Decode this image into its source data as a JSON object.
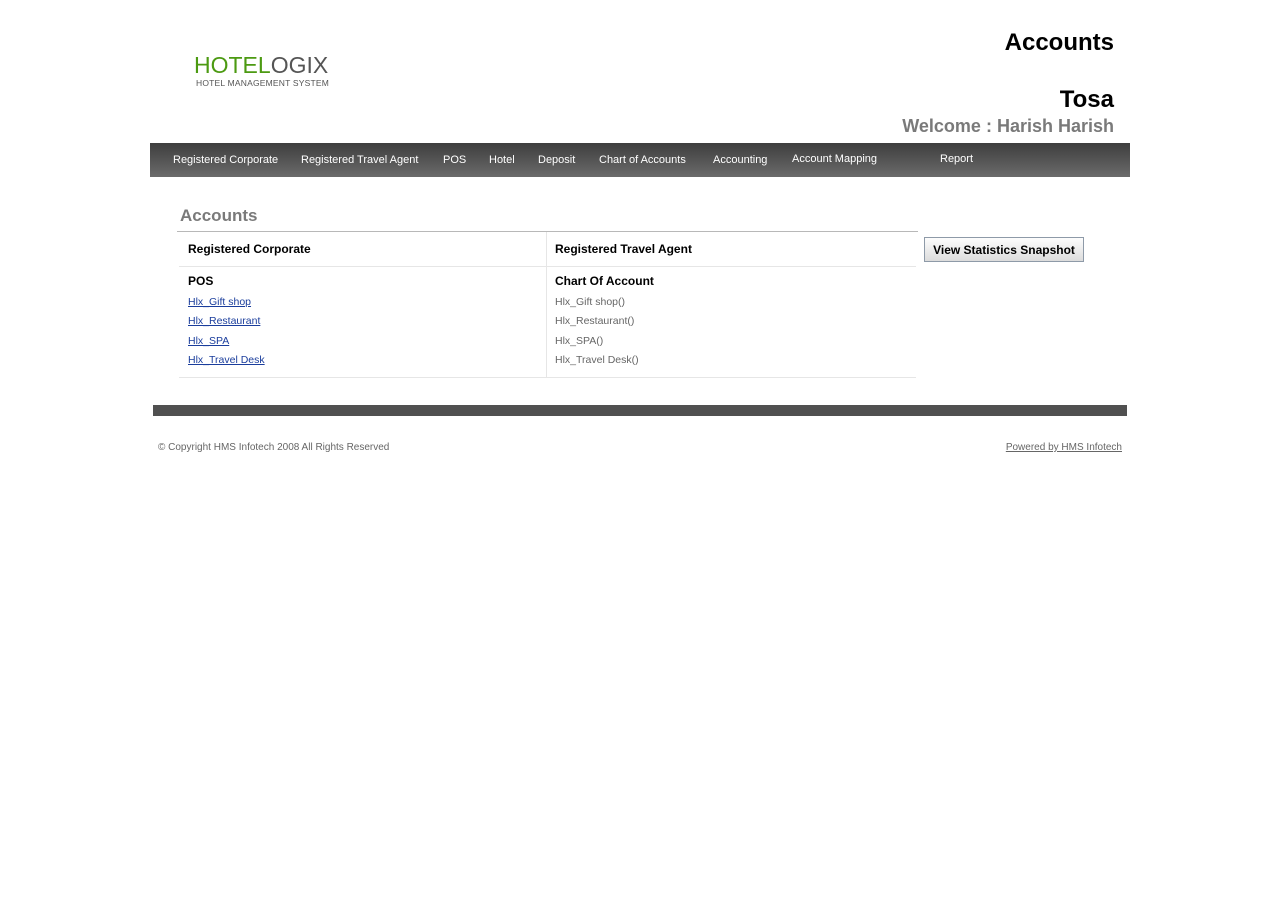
{
  "header": {
    "logo_part1": "HOTEL",
    "logo_part2": "OGIX",
    "logo_subtitle": "HOTEL MANAGEMENT SYSTEM",
    "page_heading": "Accounts",
    "hotel_name": "Tosa",
    "welcome": "Welcome : Harish Harish"
  },
  "nav": {
    "items": [
      {
        "label": "Registered Corporate"
      },
      {
        "label": "Registered Travel Agent"
      },
      {
        "label": "POS"
      },
      {
        "label": "Hotel"
      },
      {
        "label": "Deposit"
      },
      {
        "label": "Chart of Accounts"
      },
      {
        "label": "Accounting"
      },
      {
        "label": "Account Mapping"
      },
      {
        "label": "Report"
      }
    ]
  },
  "main": {
    "section_title": "Accounts",
    "registered_corporate": "Registered Corporate",
    "registered_travel_agent": "Registered Travel Agent",
    "pos_heading": "POS",
    "pos_links": [
      "Hlx_Gift shop",
      "Hlx_Restaurant",
      "Hlx_SPA",
      "Hlx_Travel Desk"
    ],
    "coa_heading": "Chart Of Account",
    "coa_items": [
      "Hlx_Gift shop()",
      "Hlx_Restaurant()",
      "Hlx_SPA()",
      "Hlx_Travel Desk()"
    ],
    "stats_button": "View Statistics Snapshot"
  },
  "footer": {
    "copyright": "© Copyright HMS Infotech 2008 All Rights Reserved",
    "powered": "Powered by HMS Infotech"
  }
}
